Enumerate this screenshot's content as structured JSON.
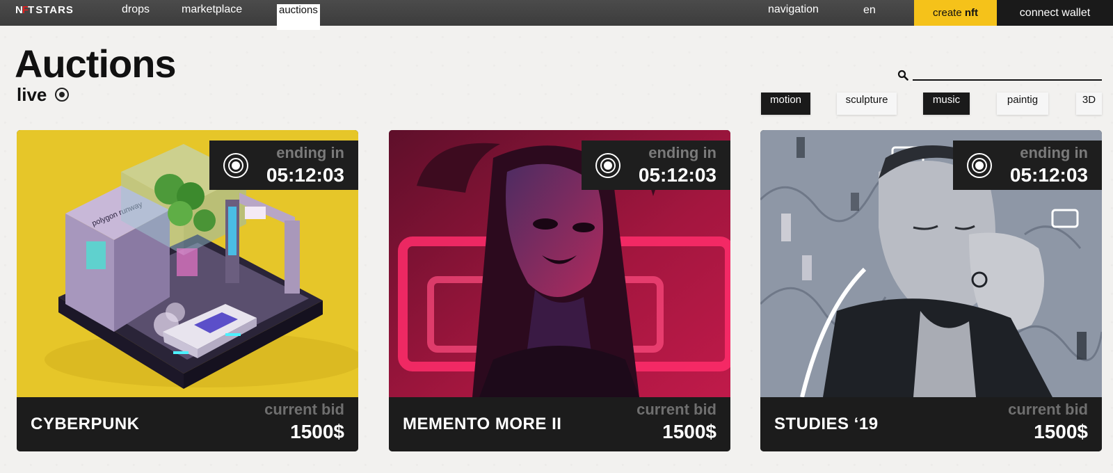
{
  "brand": {
    "logo_mark": "N",
    "logo_mark_red": "F",
    "logo_mark_end": "T",
    "name": "STARS"
  },
  "nav": {
    "links": [
      "drops",
      "marketplace",
      "auctions"
    ],
    "active": "auctions",
    "navigation": "navigation",
    "language": "en",
    "create_prefix": "create",
    "create_bold": "nft",
    "connect": "connect wallet"
  },
  "page": {
    "title": "Auctions",
    "subtitle": "live"
  },
  "search": {
    "placeholder": ""
  },
  "filters": [
    {
      "label": "motion",
      "selected": true
    },
    {
      "label": "sculpture",
      "selected": false
    },
    {
      "label": "music",
      "selected": true
    },
    {
      "label": "paintig",
      "selected": false
    },
    {
      "label": "3D",
      "selected": false
    }
  ],
  "cards": [
    {
      "title": "CYBERPUNK",
      "timer_label": "ending in",
      "timer": "05:12:03",
      "bid_label": "current bid",
      "bid": "1500$"
    },
    {
      "title": "MEMENTO MORE II",
      "timer_label": "ending in",
      "timer": "05:12:03",
      "bid_label": "current bid",
      "bid": "1500$"
    },
    {
      "title": "STUDIES ‘19",
      "timer_label": "ending in",
      "timer": "05:12:03",
      "bid_label": "current bid",
      "bid": "1500$"
    }
  ],
  "colors": {
    "accent": "#f5c21a",
    "dark": "#1c1c1c",
    "topbar": "#444444"
  }
}
